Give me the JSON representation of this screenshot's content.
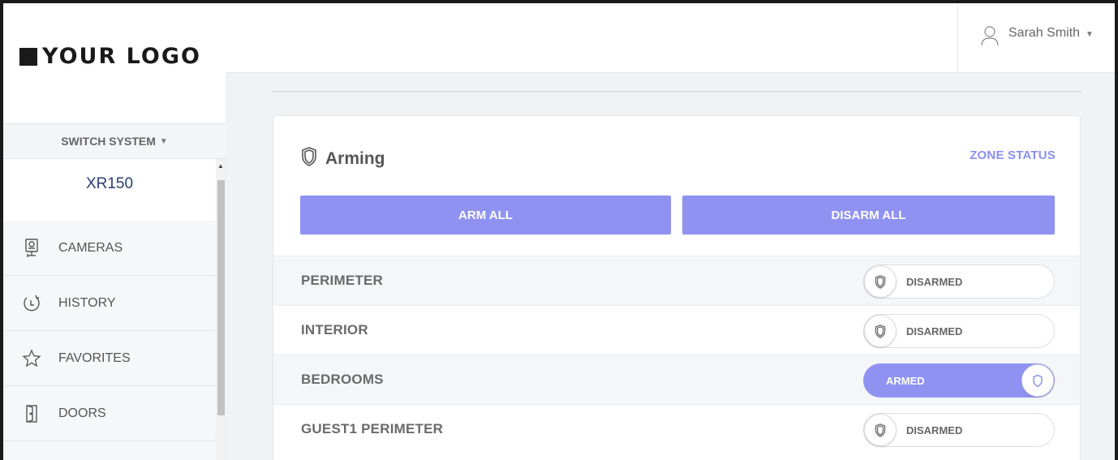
{
  "brand": {
    "logo_text": "YOUR LOGO"
  },
  "user": {
    "name": "Sarah Smith",
    "icon": "user-icon"
  },
  "sidebar": {
    "switch_system_label": "SWITCH SYSTEM",
    "system_name": "XR150",
    "items": [
      {
        "label": "CAMERAS",
        "icon": "camera-icon"
      },
      {
        "label": "HISTORY",
        "icon": "history-icon"
      },
      {
        "label": "FAVORITES",
        "icon": "star-icon"
      },
      {
        "label": "DOORS",
        "icon": "door-icon"
      }
    ]
  },
  "arming": {
    "title": "Arming",
    "zone_status_label": "ZONE STATUS",
    "arm_all_label": "ARM ALL",
    "disarm_all_label": "DISARM ALL",
    "areas": [
      {
        "name": "PERIMETER",
        "status": "DISARMED",
        "armed": false
      },
      {
        "name": "INTERIOR",
        "status": "DISARMED",
        "armed": false
      },
      {
        "name": "BEDROOMS",
        "status": "ARMED",
        "armed": true
      },
      {
        "name": "GUEST1 PERIMETER",
        "status": "DISARMED",
        "armed": false
      }
    ]
  },
  "colors": {
    "accent": "#8f92f1",
    "system_name": "#2b3e72",
    "logo": "#1a1a1a"
  }
}
